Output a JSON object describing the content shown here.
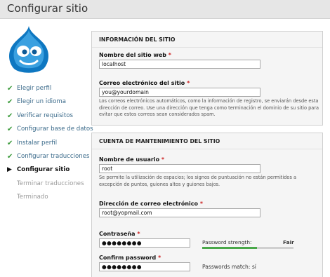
{
  "page": {
    "title": "Configurar sitio"
  },
  "sidebar": {
    "steps": [
      {
        "label": "Elegir perfil",
        "state": "done"
      },
      {
        "label": "Elegir un idioma",
        "state": "done"
      },
      {
        "label": "Verificar requisitos",
        "state": "done"
      },
      {
        "label": "Configurar base de datos",
        "state": "done"
      },
      {
        "label": "Instalar perfil",
        "state": "done"
      },
      {
        "label": "Configurar traducciones",
        "state": "done"
      },
      {
        "label": "Configurar sitio",
        "state": "active"
      },
      {
        "label": "Terminar traducciones",
        "state": "pending"
      },
      {
        "label": "Terminado",
        "state": "pending"
      }
    ]
  },
  "site_info": {
    "legend": "INFORMACIÓN DEL SITIO",
    "name_label": "Nombre del sitio web",
    "name_value": "localhost",
    "email_label": "Correo electrónico del sitio",
    "email_value": "you@yourdomain",
    "email_help": "Los correos electrónicos automáticos, como la información de registro, se enviarán desde esta dirección de correo. Use una dirección que tenga como terminación el dominio de su sitio para evitar que estos correos sean considerados spam."
  },
  "maintenance": {
    "legend": "CUENTA DE MANTENIMIENTO DEL SITIO",
    "username_label": "Nombre de usuario",
    "username_value": "root",
    "username_help": "Se permite la utilización de espacios; los signos de puntuación no están permitidos a excepción de puntos, guiones altos y guiones bajos.",
    "email_label": "Dirección de correo electrónico",
    "email_value": "root@yopmail.com",
    "password_label": "Contraseña",
    "password_value": "●●●●●●●●",
    "strength_label": "Password strength:",
    "strength_value": "Fair",
    "strength_fraction": 0.6,
    "confirm_label": "Confirm password",
    "confirm_value": "●●●●●●●●",
    "match_text": "Passwords match: sí"
  },
  "required_mark": "*",
  "icons": {
    "done": "check-icon",
    "active": "arrow-right-icon",
    "logo": "drupal-logo"
  },
  "colors": {
    "logo_blue": "#0e77c1",
    "done_check": "#3a9a3a",
    "strength_bar": "#4aa84a",
    "required": "#cc2222"
  }
}
